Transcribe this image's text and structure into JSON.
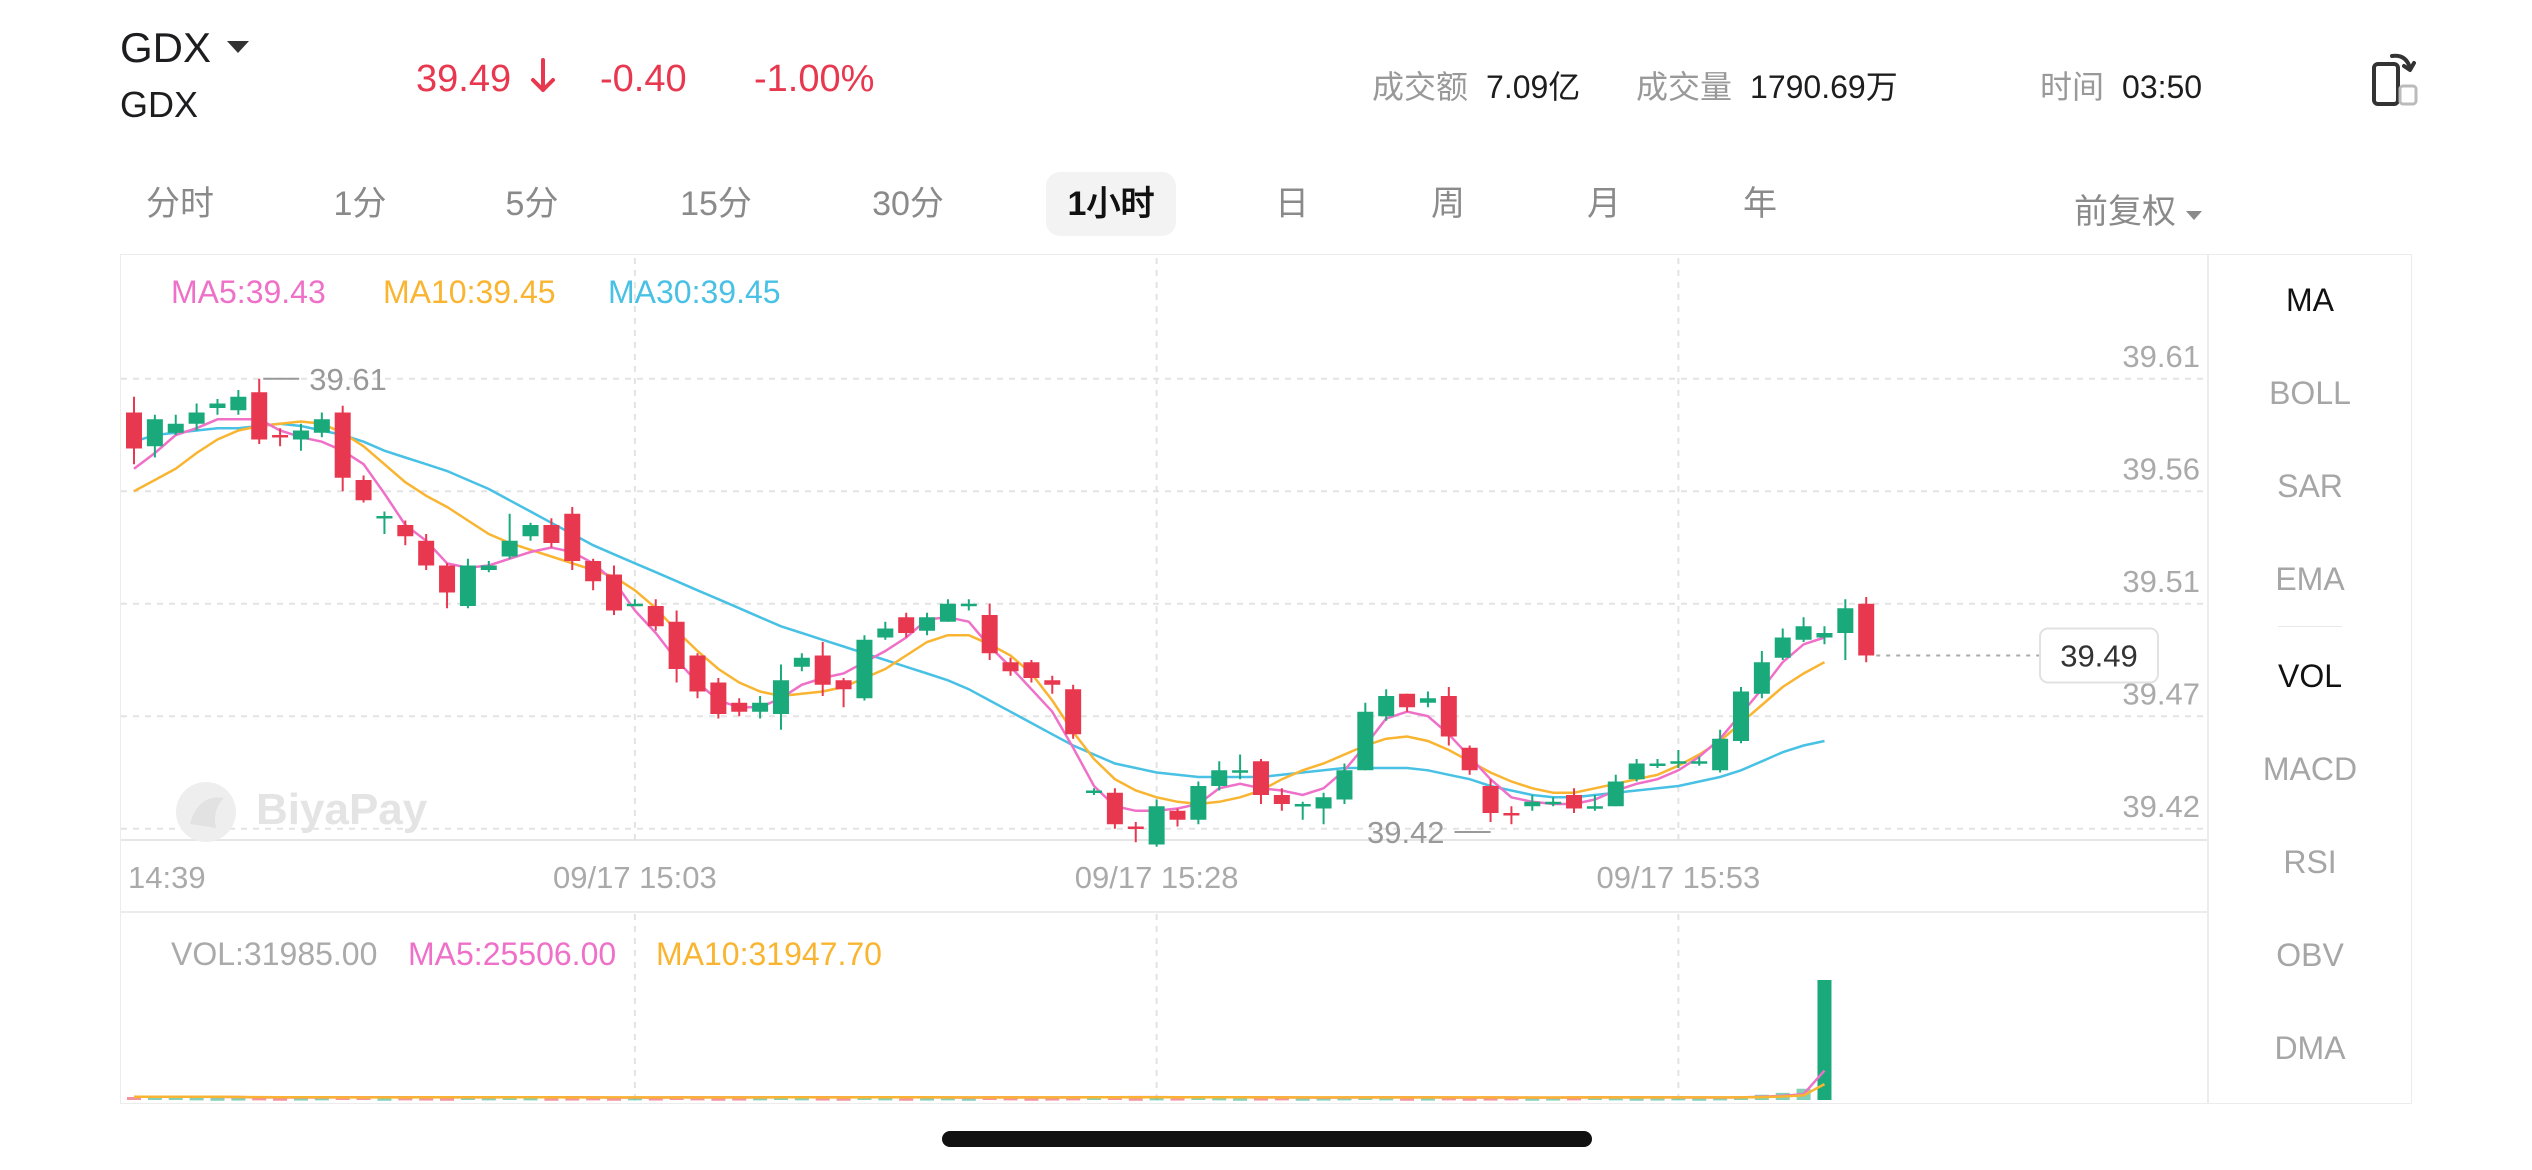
{
  "header": {
    "symbol": "GDX",
    "name": "GDX",
    "price": "39.49",
    "change": "-0.40",
    "change_pct": "-1.00%",
    "turnover_label": "成交额",
    "turnover_value": "7.09亿",
    "volume_label": "成交量",
    "volume_value": "1790.69万",
    "time_label": "时间",
    "time_value": "03:50"
  },
  "periods": [
    "分时",
    "1分",
    "5分",
    "15分",
    "30分",
    "1小时",
    "日",
    "周",
    "月",
    "年"
  ],
  "active_period": "1小时",
  "adjust_label": "前复权",
  "indicators": [
    "MA",
    "BOLL",
    "SAR",
    "EMA",
    "VOL",
    "MACD",
    "RSI",
    "OBV",
    "DMA"
  ],
  "active_indicators": [
    "MA",
    "VOL"
  ],
  "colors": {
    "up": "#19a97b",
    "down": "#e8384f",
    "ma5": "#ef70c8",
    "ma10": "#f9b531",
    "ma30": "#48c1e5",
    "grid": "#e3e3e3",
    "axis_text": "#aaaaaa"
  },
  "chart_data": {
    "type": "candlestick",
    "watermark": "BiyaPay",
    "legend": {
      "ma5": "MA5:39.43",
      "ma10": "MA10:39.45",
      "ma30": "MA30:39.45"
    },
    "y_ticks": [
      "39.61",
      "39.56",
      "39.51",
      "39.47",
      "39.42"
    ],
    "y_tick_values": [
      39.61,
      39.56,
      39.51,
      39.46,
      39.41
    ],
    "ylim": [
      39.405,
      39.665
    ],
    "x_ticks": [
      {
        "label": "14:39",
        "index": 0
      },
      {
        "label": "09/17 15:03",
        "index": 24
      },
      {
        "label": "09/17 15:28",
        "index": 49
      },
      {
        "label": "09/17 15:53",
        "index": 74
      }
    ],
    "max_label": {
      "text": "39.61",
      "index": 6,
      "value": 39.61
    },
    "min_label": {
      "text": "39.42",
      "index": 65,
      "value": 39.413
    },
    "last_price_label": "39.49",
    "last_price": 39.487,
    "candles": [
      [
        39.595,
        39.579,
        39.602,
        39.572
      ],
      [
        39.58,
        39.592,
        39.594,
        39.575
      ],
      [
        39.586,
        39.59,
        39.594,
        39.585
      ],
      [
        39.59,
        39.595,
        39.599,
        39.587
      ],
      [
        39.597,
        39.599,
        39.601,
        39.594
      ],
      [
        39.596,
        39.602,
        39.605,
        39.594
      ],
      [
        39.604,
        39.583,
        39.61,
        39.581
      ],
      [
        39.585,
        39.584,
        39.588,
        39.58
      ],
      [
        39.583,
        39.587,
        39.59,
        39.578
      ],
      [
        39.586,
        39.592,
        39.595,
        39.584
      ],
      [
        39.595,
        39.566,
        39.598,
        39.56
      ],
      [
        39.565,
        39.556,
        39.567,
        39.555
      ],
      [
        39.549,
        39.549,
        39.551,
        39.541
      ],
      [
        39.545,
        39.54,
        39.547,
        39.536
      ],
      [
        39.538,
        39.527,
        39.541,
        39.525
      ],
      [
        39.527,
        39.515,
        39.528,
        39.508
      ],
      [
        39.509,
        39.527,
        39.53,
        39.508
      ],
      [
        39.525,
        39.527,
        39.529,
        39.524
      ],
      [
        39.531,
        39.538,
        39.55,
        39.53
      ],
      [
        39.54,
        39.545,
        39.546,
        39.538
      ],
      [
        39.545,
        39.537,
        39.548,
        39.535
      ],
      [
        39.55,
        39.529,
        39.553,
        39.525
      ],
      [
        39.529,
        39.52,
        39.53,
        39.516
      ],
      [
        39.523,
        39.507,
        39.527,
        39.505
      ],
      [
        39.51,
        39.51,
        39.512,
        39.509
      ],
      [
        39.509,
        39.5,
        39.512,
        39.498
      ],
      [
        39.502,
        39.481,
        39.507,
        39.475
      ],
      [
        39.487,
        39.471,
        39.488,
        39.468
      ],
      [
        39.475,
        39.461,
        39.477,
        39.459
      ],
      [
        39.466,
        39.462,
        39.468,
        39.46
      ],
      [
        39.462,
        39.466,
        39.469,
        39.459
      ],
      [
        39.461,
        39.476,
        39.483,
        39.454
      ],
      [
        39.482,
        39.486,
        39.488,
        39.48
      ],
      [
        39.487,
        39.474,
        39.493,
        39.469
      ],
      [
        39.476,
        39.472,
        39.477,
        39.464
      ],
      [
        39.468,
        39.494,
        39.496,
        39.467
      ],
      [
        39.495,
        39.499,
        39.502,
        39.494
      ],
      [
        39.504,
        39.497,
        39.506,
        39.495
      ],
      [
        39.498,
        39.504,
        39.506,
        39.496
      ],
      [
        39.502,
        39.51,
        39.512,
        39.502
      ],
      [
        39.51,
        39.51,
        39.512,
        39.507
      ],
      [
        39.505,
        39.488,
        39.51,
        39.485
      ],
      [
        39.484,
        39.48,
        39.486,
        39.478
      ],
      [
        39.484,
        39.477,
        39.485,
        39.475
      ],
      [
        39.476,
        39.474,
        39.478,
        39.47
      ],
      [
        39.472,
        39.452,
        39.474,
        39.45
      ],
      [
        39.427,
        39.427,
        39.428,
        39.425
      ],
      [
        39.426,
        39.412,
        39.428,
        39.41
      ],
      [
        39.411,
        39.41,
        39.413,
        39.404
      ],
      [
        39.403,
        39.42,
        39.423,
        39.402
      ],
      [
        39.418,
        39.414,
        39.419,
        39.411
      ],
      [
        39.414,
        39.429,
        39.431,
        39.412
      ],
      [
        39.429,
        39.436,
        39.44,
        39.427
      ],
      [
        39.436,
        39.436,
        39.443,
        39.432
      ],
      [
        39.44,
        39.425,
        39.441,
        39.421
      ],
      [
        39.425,
        39.421,
        39.428,
        39.418
      ],
      [
        39.42,
        39.421,
        39.422,
        39.414
      ],
      [
        39.419,
        39.424,
        39.426,
        39.412
      ],
      [
        39.423,
        39.436,
        39.439,
        39.421
      ],
      [
        39.436,
        39.462,
        39.466,
        39.436
      ],
      [
        39.46,
        39.469,
        39.472,
        39.458
      ],
      [
        39.47,
        39.464,
        39.47,
        39.462
      ],
      [
        39.466,
        39.468,
        39.471,
        39.464
      ],
      [
        39.469,
        39.451,
        39.473,
        39.447
      ],
      [
        39.446,
        39.436,
        39.447,
        39.434
      ],
      [
        39.429,
        39.417,
        39.432,
        39.413
      ],
      [
        39.417,
        39.416,
        39.42,
        39.412
      ],
      [
        39.42,
        39.422,
        39.425,
        39.418
      ],
      [
        39.422,
        39.422,
        39.424,
        39.42
      ],
      [
        39.425,
        39.419,
        39.428,
        39.417
      ],
      [
        39.42,
        39.42,
        39.425,
        39.418
      ],
      [
        39.42,
        39.431,
        39.434,
        39.42
      ],
      [
        39.432,
        39.439,
        39.441,
        39.431
      ],
      [
        39.438,
        39.439,
        39.441,
        39.437
      ],
      [
        39.439,
        39.44,
        39.445,
        39.437
      ],
      [
        39.44,
        39.44,
        39.442,
        39.438
      ],
      [
        39.436,
        39.45,
        39.454,
        39.435
      ],
      [
        39.449,
        39.471,
        39.473,
        39.448
      ],
      [
        39.47,
        39.484,
        39.489,
        39.468
      ],
      [
        39.486,
        39.495,
        39.499,
        39.485
      ],
      [
        39.494,
        39.5,
        39.504,
        39.493
      ],
      [
        39.495,
        39.497,
        39.5,
        39.492
      ],
      [
        39.497,
        39.508,
        39.512,
        39.485
      ],
      [
        39.51,
        39.487,
        39.513,
        39.484
      ]
    ],
    "ma5": [
      39.57,
      39.577,
      39.585,
      39.588,
      39.592,
      39.592,
      39.592,
      39.587,
      39.584,
      39.582,
      39.578,
      39.572,
      39.559,
      39.545,
      39.538,
      39.528,
      39.526,
      39.527,
      39.53,
      39.533,
      39.535,
      39.533,
      39.528,
      39.52,
      39.507,
      39.497,
      39.485,
      39.475,
      39.467,
      39.464,
      39.464,
      39.468,
      39.474,
      39.477,
      39.479,
      39.484,
      39.489,
      39.495,
      39.503,
      39.504,
      39.502,
      39.491,
      39.482,
      39.472,
      39.462,
      39.446,
      39.429,
      39.42,
      39.418,
      39.418,
      39.419,
      39.421,
      39.428,
      39.43,
      39.428,
      39.427,
      39.425,
      39.428,
      39.436,
      39.447,
      39.459,
      39.462,
      39.46,
      39.452,
      39.442,
      39.432,
      39.424,
      39.422,
      39.421,
      39.421,
      39.423,
      39.427,
      39.43,
      39.432,
      39.436,
      39.442,
      39.45,
      39.461,
      39.472,
      39.484,
      39.492,
      39.495
    ],
    "ma10": [
      39.56,
      39.565,
      39.57,
      39.577,
      39.583,
      39.587,
      39.589,
      39.59,
      39.591,
      39.59,
      39.586,
      39.58,
      39.572,
      39.564,
      39.558,
      39.553,
      39.547,
      39.541,
      39.537,
      39.534,
      39.531,
      39.528,
      39.525,
      39.522,
      39.516,
      39.508,
      39.498,
      39.489,
      39.481,
      39.475,
      39.471,
      39.469,
      39.47,
      39.471,
      39.473,
      39.477,
      39.481,
      39.487,
      39.493,
      39.496,
      39.496,
      39.492,
      39.487,
      39.479,
      39.467,
      39.453,
      39.441,
      39.432,
      39.427,
      39.424,
      39.422,
      39.421,
      39.422,
      39.424,
      39.427,
      39.432,
      39.436,
      39.439,
      39.443,
      39.447,
      39.45,
      39.451,
      39.449,
      39.445,
      39.44,
      39.435,
      39.431,
      39.428,
      39.426,
      39.426,
      39.428,
      39.43,
      39.432,
      39.434,
      39.438,
      39.443,
      39.449,
      39.457,
      39.465,
      39.473,
      39.479,
      39.484
    ],
    "ma30": [
      39.582,
      39.585,
      39.586,
      39.587,
      39.588,
      39.588,
      39.589,
      39.59,
      39.589,
      39.587,
      39.585,
      39.582,
      39.578,
      39.575,
      39.572,
      39.569,
      39.565,
      39.561,
      39.556,
      39.551,
      39.546,
      39.541,
      39.536,
      39.532,
      39.528,
      39.524,
      39.52,
      39.516,
      39.512,
      39.508,
      39.504,
      39.5,
      39.497,
      39.494,
      39.491,
      39.488,
      39.485,
      39.482,
      39.479,
      39.476,
      39.472,
      39.467,
      39.462,
      39.457,
      39.452,
      39.447,
      39.443,
      39.439,
      39.437,
      39.435,
      39.434,
      39.433,
      39.433,
      39.433,
      39.433,
      39.434,
      39.435,
      39.436,
      39.437,
      39.437,
      39.437,
      39.437,
      39.436,
      39.434,
      39.432,
      39.429,
      39.427,
      39.425,
      39.424,
      39.424,
      39.425,
      39.426,
      39.427,
      39.428,
      39.429,
      39.431,
      39.433,
      39.436,
      39.44,
      39.444,
      39.447,
      39.449
    ],
    "volume": {
      "legend": {
        "vol": "VOL:31985.00",
        "ma5": "MA5:25506.00",
        "ma10": "MA10:31947.70"
      },
      "values": [
        800,
        1100,
        900,
        700,
        600,
        650,
        700,
        600,
        650,
        700,
        900,
        800,
        600,
        700,
        650,
        600,
        800,
        700,
        900,
        700,
        600,
        650,
        700,
        600,
        700,
        650,
        800,
        700,
        600,
        650,
        700,
        900,
        700,
        650,
        600,
        800,
        700,
        600,
        650,
        700,
        600,
        800,
        700,
        600,
        650,
        700,
        900,
        800,
        600,
        700,
        650,
        800,
        700,
        600,
        650,
        700,
        600,
        650,
        700,
        800,
        700,
        600,
        650,
        700,
        600,
        650,
        700,
        600,
        650,
        700,
        800,
        700,
        600,
        650,
        700,
        600,
        700,
        900,
        1400,
        1900,
        3000,
        31985
      ],
      "ma5": [
        850,
        850,
        850,
        850,
        820,
        790,
        690,
        660,
        660,
        660,
        710,
        730,
        730,
        730,
        730,
        690,
        700,
        690,
        730,
        740,
        740,
        710,
        690,
        650,
        660,
        650,
        690,
        690,
        690,
        690,
        690,
        750,
        740,
        720,
        720,
        730,
        720,
        710,
        700,
        680,
        650,
        700,
        690,
        670,
        670,
        690,
        710,
        750,
        760,
        760,
        730,
        730,
        710,
        710,
        690,
        690,
        670,
        650,
        670,
        690,
        680,
        690,
        690,
        670,
        650,
        660,
        660,
        650,
        650,
        660,
        680,
        700,
        690,
        680,
        680,
        670,
        670,
        700,
        840,
        1100,
        1580,
        7840
      ],
      "ma10": [
        850,
        850,
        850,
        850,
        850,
        800,
        780,
        740,
        720,
        710,
        700,
        700,
        690,
        690,
        710,
        710,
        710,
        710,
        720,
        720,
        710,
        700,
        700,
        700,
        690,
        680,
        700,
        700,
        690,
        680,
        690,
        720,
        710,
        700,
        700,
        720,
        730,
        720,
        710,
        700,
        680,
        700,
        700,
        690,
        690,
        700,
        710,
        720,
        720,
        720,
        720,
        720,
        720,
        710,
        700,
        700,
        690,
        690,
        690,
        700,
        690,
        690,
        690,
        690,
        680,
        680,
        670,
        670,
        670,
        680,
        680,
        680,
        680,
        680,
        680,
        680,
        680,
        690,
        760,
        920,
        1220,
        4240
      ]
    }
  }
}
